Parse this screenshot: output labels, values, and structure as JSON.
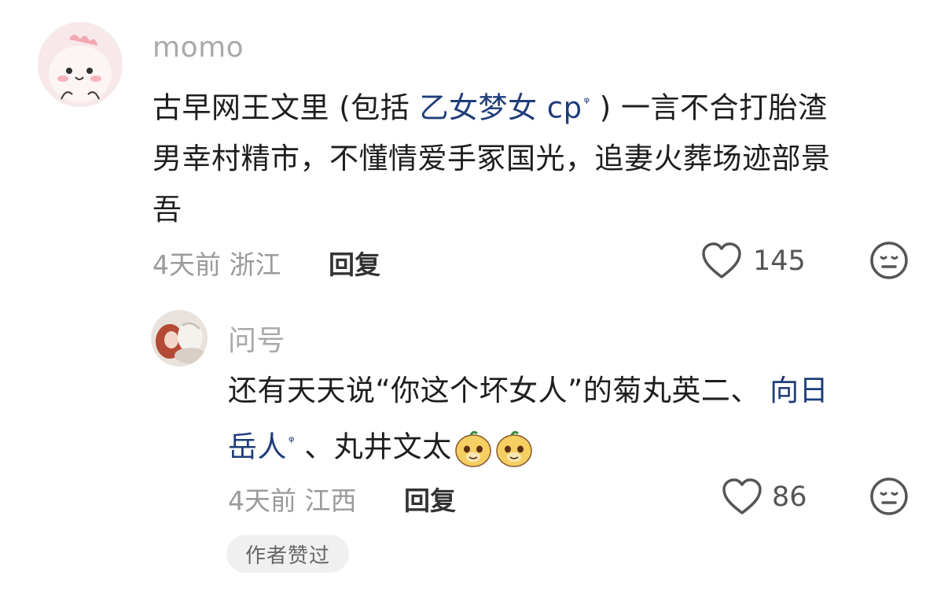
{
  "comment": {
    "username": "momo",
    "text_before": "古早网王文里 (包括 ",
    "link_text": "乙女梦女 cp",
    "text_after_line1": " ) 一言不合打胎渣",
    "text_line2": "男幸村精市，不懂情爱手冢国光，追妻火葬场迹部景",
    "text_line3": "吾",
    "meta": "4天前 浙江",
    "reply_label": "回复",
    "likes": "145",
    "avatar_icon": "cartoon-chick-avatar",
    "like_icon": "heart-outline-icon",
    "reaction_icon": "neutral-face-icon"
  },
  "reply": {
    "username": "问号",
    "text_line1": "还有天天说“你这个坏女人”的菊丸英二、 ",
    "link1_text": "向日",
    "link2_text": "岳人",
    "text_after_link": " 、丸井文太",
    "meta": "4天前 江西",
    "reply_label": "回复",
    "likes": "86",
    "badge": "作者赞过",
    "avatar_icon": "anime-illustration-avatar",
    "sticker_icon": "yellow-dog-sticker"
  },
  "search_marker": "ᵠ",
  "colors": {
    "link": "#1f3d7a",
    "meta": "#9a9a9a",
    "badge_bg": "#f0f0f0"
  }
}
